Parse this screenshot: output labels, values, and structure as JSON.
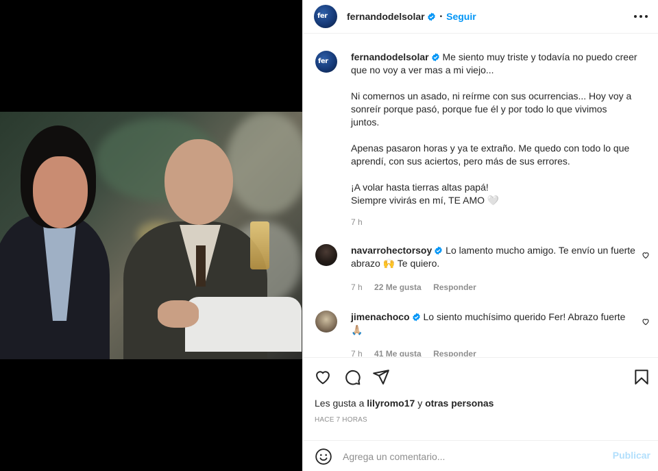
{
  "post": {
    "author": "fernandodelsolar",
    "avatar_text": "fer",
    "follow_label": "Seguir",
    "separator": "•"
  },
  "caption": {
    "author": "fernandodelsolar",
    "paragraphs": [
      "Me siento muy triste y todavía no puedo creer que no voy a ver mas a mi viejo...",
      "Ni comernos un asado, ni reírme con sus ocurrencias... Hoy voy a sonreír porque pasó, porque fue él y por todo lo que vivimos juntos.",
      "Apenas pasaron horas y ya te extraño. Me quedo con todo lo que aprendí, con sus aciertos, pero más de sus errores.",
      "¡A volar hasta tierras altas papá!",
      "Siempre vivirás en mí, TE AMO 🤍"
    ],
    "time": "7 h"
  },
  "comments": [
    {
      "user": "navarrohectorsoy",
      "text": "Lo lamento mucho amigo. Te envío un fuerte abrazo 🙌 Te quiero.",
      "time": "7 h",
      "likes": "22 Me gusta",
      "reply": "Responder"
    },
    {
      "user": "jimenachoco",
      "text": "Lo siento muchísimo querido Fer! Abrazo fuerte 🙏🏼",
      "time": "7 h",
      "likes": "41 Me gusta",
      "reply": "Responder"
    }
  ],
  "actions": {
    "likes_prefix": "Les gusta a",
    "likes_user": "lilyromo17",
    "likes_joiner": "y",
    "likes_others": "otras personas",
    "time_ago": "HACE 7 HORAS",
    "comment_placeholder": "Agrega un comentario...",
    "publish_label": "Publicar"
  },
  "icons": {
    "verified": "verified-badge-icon",
    "more": "more-options-icon",
    "like": "heart-icon",
    "comment": "comment-icon",
    "share": "send-icon",
    "save": "bookmark-icon",
    "emoji": "emoji-icon"
  },
  "colors": {
    "accent": "#0095f6",
    "publish_disabled": "#b2dffc",
    "muted": "#8e8e8e",
    "text": "#262626"
  }
}
